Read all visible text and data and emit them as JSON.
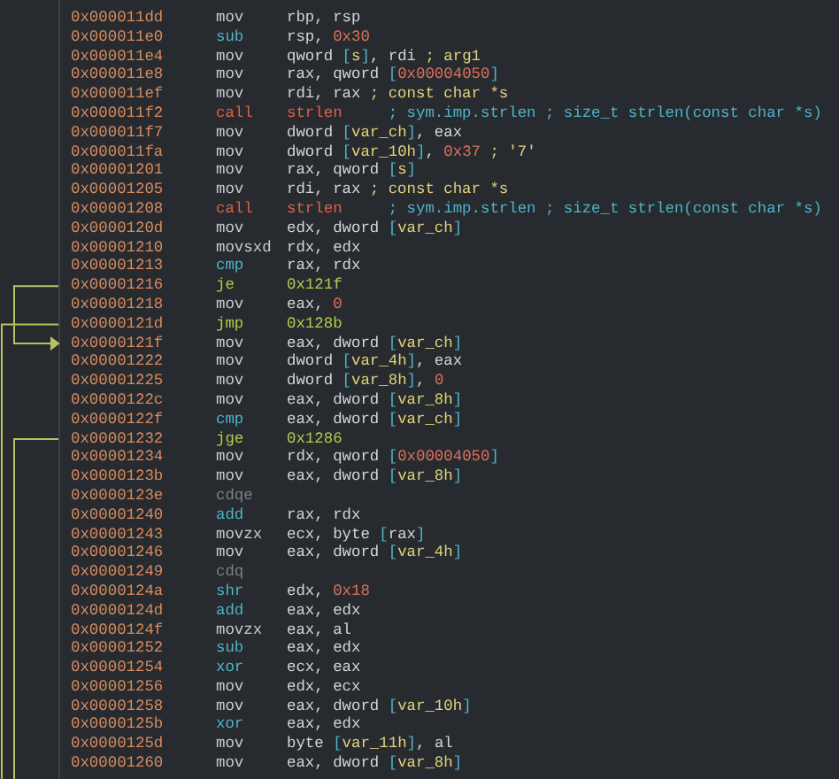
{
  "rows": [
    {
      "address": "0x000011dd",
      "mnemonic": "mov",
      "kind": "mov",
      "operands": [
        {
          "kind": "reg",
          "text": "rbp, rsp"
        }
      ]
    },
    {
      "address": "0x000011e0",
      "mnemonic": "sub",
      "kind": "arith",
      "operands": [
        {
          "kind": "reg",
          "text": "rsp, "
        },
        {
          "kind": "num",
          "text": "0x30"
        }
      ]
    },
    {
      "address": "0x000011e4",
      "mnemonic": "mov",
      "kind": "mov",
      "operands": [
        {
          "kind": "reg",
          "text": "qword "
        },
        {
          "kind": "bracket",
          "text": "["
        },
        {
          "kind": "var",
          "text": "s"
        },
        {
          "kind": "bracket",
          "text": "]"
        },
        {
          "kind": "reg",
          "text": ", rdi"
        },
        {
          "kind": "comment",
          "text": "; arg1"
        }
      ]
    },
    {
      "address": "0x000011e8",
      "mnemonic": "mov",
      "kind": "mov",
      "operands": [
        {
          "kind": "reg",
          "text": "rax, qword "
        },
        {
          "kind": "bracket",
          "text": "["
        },
        {
          "kind": "num",
          "text": "0x00004050"
        },
        {
          "kind": "bracket",
          "text": "]"
        }
      ]
    },
    {
      "address": "0x000011ef",
      "mnemonic": "mov",
      "kind": "mov",
      "operands": [
        {
          "kind": "reg",
          "text": "rdi, rax"
        },
        {
          "kind": "comment",
          "text": "; const char *s"
        }
      ]
    },
    {
      "address": "0x000011f2",
      "mnemonic": "call",
      "kind": "call",
      "operands": [
        {
          "kind": "callee",
          "text": "strlen"
        },
        {
          "kind": "sym",
          "text": "; sym.imp.strlen ; size_t strlen(const char *s)"
        }
      ]
    },
    {
      "address": "0x000011f7",
      "mnemonic": "mov",
      "kind": "mov",
      "operands": [
        {
          "kind": "reg",
          "text": "dword "
        },
        {
          "kind": "bracket",
          "text": "["
        },
        {
          "kind": "var",
          "text": "var_ch"
        },
        {
          "kind": "bracket",
          "text": "]"
        },
        {
          "kind": "reg",
          "text": ", eax"
        }
      ]
    },
    {
      "address": "0x000011fa",
      "mnemonic": "mov",
      "kind": "mov",
      "operands": [
        {
          "kind": "reg",
          "text": "dword "
        },
        {
          "kind": "bracket",
          "text": "["
        },
        {
          "kind": "var",
          "text": "var_10h"
        },
        {
          "kind": "bracket",
          "text": "]"
        },
        {
          "kind": "reg",
          "text": ", "
        },
        {
          "kind": "num",
          "text": "0x37"
        },
        {
          "kind": "comment",
          "text": "; '7'"
        }
      ]
    },
    {
      "address": "0x00001201",
      "mnemonic": "mov",
      "kind": "mov",
      "operands": [
        {
          "kind": "reg",
          "text": "rax, qword "
        },
        {
          "kind": "bracket",
          "text": "["
        },
        {
          "kind": "var",
          "text": "s"
        },
        {
          "kind": "bracket",
          "text": "]"
        }
      ]
    },
    {
      "address": "0x00001205",
      "mnemonic": "mov",
      "kind": "mov",
      "operands": [
        {
          "kind": "reg",
          "text": "rdi, rax"
        },
        {
          "kind": "comment",
          "text": "; const char *s"
        }
      ]
    },
    {
      "address": "0x00001208",
      "mnemonic": "call",
      "kind": "call",
      "operands": [
        {
          "kind": "callee",
          "text": "strlen"
        },
        {
          "kind": "sym",
          "text": "; sym.imp.strlen ; size_t strlen(const char *s)"
        }
      ]
    },
    {
      "address": "0x0000120d",
      "mnemonic": "mov",
      "kind": "mov",
      "operands": [
        {
          "kind": "reg",
          "text": "edx, dword "
        },
        {
          "kind": "bracket",
          "text": "["
        },
        {
          "kind": "var",
          "text": "var_ch"
        },
        {
          "kind": "bracket",
          "text": "]"
        }
      ]
    },
    {
      "address": "0x00001210",
      "mnemonic": "movsxd",
      "kind": "mov",
      "operands": [
        {
          "kind": "reg",
          "text": "rdx, edx"
        }
      ]
    },
    {
      "address": "0x00001213",
      "mnemonic": "cmp",
      "kind": "arith",
      "operands": [
        {
          "kind": "reg",
          "text": "rax, rdx"
        }
      ]
    },
    {
      "address": "0x00001216",
      "mnemonic": "je",
      "kind": "jump",
      "operands": [
        {
          "kind": "target",
          "text": "0x121f"
        }
      ]
    },
    {
      "address": "0x00001218",
      "mnemonic": "mov",
      "kind": "mov",
      "operands": [
        {
          "kind": "reg",
          "text": "eax, "
        },
        {
          "kind": "num",
          "text": "0"
        }
      ]
    },
    {
      "address": "0x0000121d",
      "mnemonic": "jmp",
      "kind": "jump",
      "operands": [
        {
          "kind": "target",
          "text": "0x128b"
        }
      ]
    },
    {
      "address": "0x0000121f",
      "mnemonic": "mov",
      "kind": "mov",
      "operands": [
        {
          "kind": "reg",
          "text": "eax, dword "
        },
        {
          "kind": "bracket",
          "text": "["
        },
        {
          "kind": "var",
          "text": "var_ch"
        },
        {
          "kind": "bracket",
          "text": "]"
        }
      ]
    },
    {
      "address": "0x00001222",
      "mnemonic": "mov",
      "kind": "mov",
      "operands": [
        {
          "kind": "reg",
          "text": "dword "
        },
        {
          "kind": "bracket",
          "text": "["
        },
        {
          "kind": "var",
          "text": "var_4h"
        },
        {
          "kind": "bracket",
          "text": "]"
        },
        {
          "kind": "reg",
          "text": ", eax"
        }
      ]
    },
    {
      "address": "0x00001225",
      "mnemonic": "mov",
      "kind": "mov",
      "operands": [
        {
          "kind": "reg",
          "text": "dword "
        },
        {
          "kind": "bracket",
          "text": "["
        },
        {
          "kind": "var",
          "text": "var_8h"
        },
        {
          "kind": "bracket",
          "text": "]"
        },
        {
          "kind": "reg",
          "text": ", "
        },
        {
          "kind": "num",
          "text": "0"
        }
      ]
    },
    {
      "address": "0x0000122c",
      "mnemonic": "mov",
      "kind": "mov",
      "operands": [
        {
          "kind": "reg",
          "text": "eax, dword "
        },
        {
          "kind": "bracket",
          "text": "["
        },
        {
          "kind": "var",
          "text": "var_8h"
        },
        {
          "kind": "bracket",
          "text": "]"
        }
      ]
    },
    {
      "address": "0x0000122f",
      "mnemonic": "cmp",
      "kind": "arith",
      "operands": [
        {
          "kind": "reg",
          "text": "eax, dword "
        },
        {
          "kind": "bracket",
          "text": "["
        },
        {
          "kind": "var",
          "text": "var_ch"
        },
        {
          "kind": "bracket",
          "text": "]"
        }
      ]
    },
    {
      "address": "0x00001232",
      "mnemonic": "jge",
      "kind": "jump",
      "operands": [
        {
          "kind": "target",
          "text": "0x1286"
        }
      ]
    },
    {
      "address": "0x00001234",
      "mnemonic": "mov",
      "kind": "mov",
      "operands": [
        {
          "kind": "reg",
          "text": "rdx, qword "
        },
        {
          "kind": "bracket",
          "text": "["
        },
        {
          "kind": "num",
          "text": "0x00004050"
        },
        {
          "kind": "bracket",
          "text": "]"
        }
      ]
    },
    {
      "address": "0x0000123b",
      "mnemonic": "mov",
      "kind": "mov",
      "operands": [
        {
          "kind": "reg",
          "text": "eax, dword "
        },
        {
          "kind": "bracket",
          "text": "["
        },
        {
          "kind": "var",
          "text": "var_8h"
        },
        {
          "kind": "bracket",
          "text": "]"
        }
      ]
    },
    {
      "address": "0x0000123e",
      "mnemonic": "cdqe",
      "kind": "dim",
      "operands": []
    },
    {
      "address": "0x00001240",
      "mnemonic": "add",
      "kind": "arith",
      "operands": [
        {
          "kind": "reg",
          "text": "rax, rdx"
        }
      ]
    },
    {
      "address": "0x00001243",
      "mnemonic": "movzx",
      "kind": "mov",
      "operands": [
        {
          "kind": "reg",
          "text": "ecx, byte "
        },
        {
          "kind": "bracket",
          "text": "["
        },
        {
          "kind": "reg",
          "text": "rax"
        },
        {
          "kind": "bracket",
          "text": "]"
        }
      ]
    },
    {
      "address": "0x00001246",
      "mnemonic": "mov",
      "kind": "mov",
      "operands": [
        {
          "kind": "reg",
          "text": "eax, dword "
        },
        {
          "kind": "bracket",
          "text": "["
        },
        {
          "kind": "var",
          "text": "var_4h"
        },
        {
          "kind": "bracket",
          "text": "]"
        }
      ]
    },
    {
      "address": "0x00001249",
      "mnemonic": "cdq",
      "kind": "dim",
      "operands": []
    },
    {
      "address": "0x0000124a",
      "mnemonic": "shr",
      "kind": "arith",
      "operands": [
        {
          "kind": "reg",
          "text": "edx, "
        },
        {
          "kind": "num",
          "text": "0x18"
        }
      ]
    },
    {
      "address": "0x0000124d",
      "mnemonic": "add",
      "kind": "arith",
      "operands": [
        {
          "kind": "reg",
          "text": "eax, edx"
        }
      ]
    },
    {
      "address": "0x0000124f",
      "mnemonic": "movzx",
      "kind": "mov",
      "operands": [
        {
          "kind": "reg",
          "text": "eax, al"
        }
      ]
    },
    {
      "address": "0x00001252",
      "mnemonic": "sub",
      "kind": "arith",
      "operands": [
        {
          "kind": "reg",
          "text": "eax, edx"
        }
      ]
    },
    {
      "address": "0x00001254",
      "mnemonic": "xor",
      "kind": "arith",
      "operands": [
        {
          "kind": "reg",
          "text": "ecx, eax"
        }
      ]
    },
    {
      "address": "0x00001256",
      "mnemonic": "mov",
      "kind": "mov",
      "operands": [
        {
          "kind": "reg",
          "text": "edx, ecx"
        }
      ]
    },
    {
      "address": "0x00001258",
      "mnemonic": "mov",
      "kind": "mov",
      "operands": [
        {
          "kind": "reg",
          "text": "eax, dword "
        },
        {
          "kind": "bracket",
          "text": "["
        },
        {
          "kind": "var",
          "text": "var_10h"
        },
        {
          "kind": "bracket",
          "text": "]"
        }
      ]
    },
    {
      "address": "0x0000125b",
      "mnemonic": "xor",
      "kind": "arith",
      "operands": [
        {
          "kind": "reg",
          "text": "eax, edx"
        }
      ]
    },
    {
      "address": "0x0000125d",
      "mnemonic": "mov",
      "kind": "mov",
      "operands": [
        {
          "kind": "reg",
          "text": "byte "
        },
        {
          "kind": "bracket",
          "text": "["
        },
        {
          "kind": "var",
          "text": "var_11h"
        },
        {
          "kind": "bracket",
          "text": "]"
        },
        {
          "kind": "reg",
          "text": ", al"
        }
      ]
    },
    {
      "address": "0x00001260",
      "mnemonic": "mov",
      "kind": "mov",
      "operands": [
        {
          "kind": "reg",
          "text": "eax, dword "
        },
        {
          "kind": "bracket",
          "text": "["
        },
        {
          "kind": "var",
          "text": "var_8h"
        },
        {
          "kind": "bracket",
          "text": "]"
        }
      ]
    }
  ]
}
